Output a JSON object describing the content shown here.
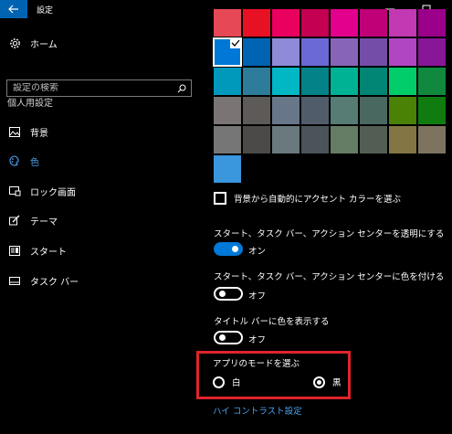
{
  "window": {
    "title": "設定",
    "back_icon": "back-arrow-icon",
    "minimize_icon": "minimize-icon",
    "maximize_icon": "maximize-icon"
  },
  "sidebar": {
    "home_label": "ホーム",
    "search_placeholder": "設定の検索",
    "section_title": "個人用設定",
    "items": [
      {
        "label": "背景",
        "icon": "picture-icon",
        "active": false
      },
      {
        "label": "色",
        "icon": "palette-icon",
        "active": true
      },
      {
        "label": "ロック画面",
        "icon": "lock-screen-icon",
        "active": false
      },
      {
        "label": "テーマ",
        "icon": "brush-icon",
        "active": false
      },
      {
        "label": "スタート",
        "icon": "start-icon",
        "active": false
      },
      {
        "label": "タスク バー",
        "icon": "taskbar-icon",
        "active": false
      }
    ]
  },
  "colors": {
    "accent": "#0078d7",
    "link": "#4aa0ea",
    "highlight_border": "#e0242b",
    "swatches": [
      [
        "#e74856",
        "#e81123",
        "#ea005e",
        "#c30052",
        "#e3008c",
        "#bf0077",
        "#c239b3",
        "#9a0089"
      ],
      [
        "#0078d7",
        "#0063b1",
        "#8e8cd8",
        "#6b69d6",
        "#8764b8",
        "#744da9",
        "#b146c2",
        "#881798"
      ],
      [
        "#0099bc",
        "#2d7d9a",
        "#00b7c3",
        "#038387",
        "#00b294",
        "#018574",
        "#00cc6a",
        "#10893e"
      ],
      [
        "#7a7574",
        "#5d5a58",
        "#68768a",
        "#515c6b",
        "#567c73",
        "#486860",
        "#498205",
        "#107c10"
      ],
      [
        "#767676",
        "#4c4a48",
        "#69797e",
        "#4a5459",
        "#647c64",
        "#525e54",
        "#847545",
        "#7e735f"
      ],
      [
        "#3a96dd"
      ]
    ],
    "selected_swatch": "#0078d7"
  },
  "settings": {
    "auto_accent_label": "背景から自動的にアクセント カラーを選ぶ",
    "auto_accent_checked": false,
    "transparency_label": "スタート、タスク バー、アクション センターを透明にする",
    "transparency_state": "オン",
    "transparency_on": true,
    "start_color_label": "スタート、タスク バー、アクション センターに色を付ける",
    "start_color_state": "オフ",
    "start_color_on": false,
    "titlebar_color_label": "タイトル バーに色を表示する",
    "titlebar_color_state": "オフ",
    "titlebar_color_on": false,
    "app_mode_label": "アプリのモードを選ぶ",
    "app_mode_options": [
      "白",
      "黒"
    ],
    "app_mode_selected": "黒",
    "high_contrast_link": "ハイ コントラスト設定"
  }
}
